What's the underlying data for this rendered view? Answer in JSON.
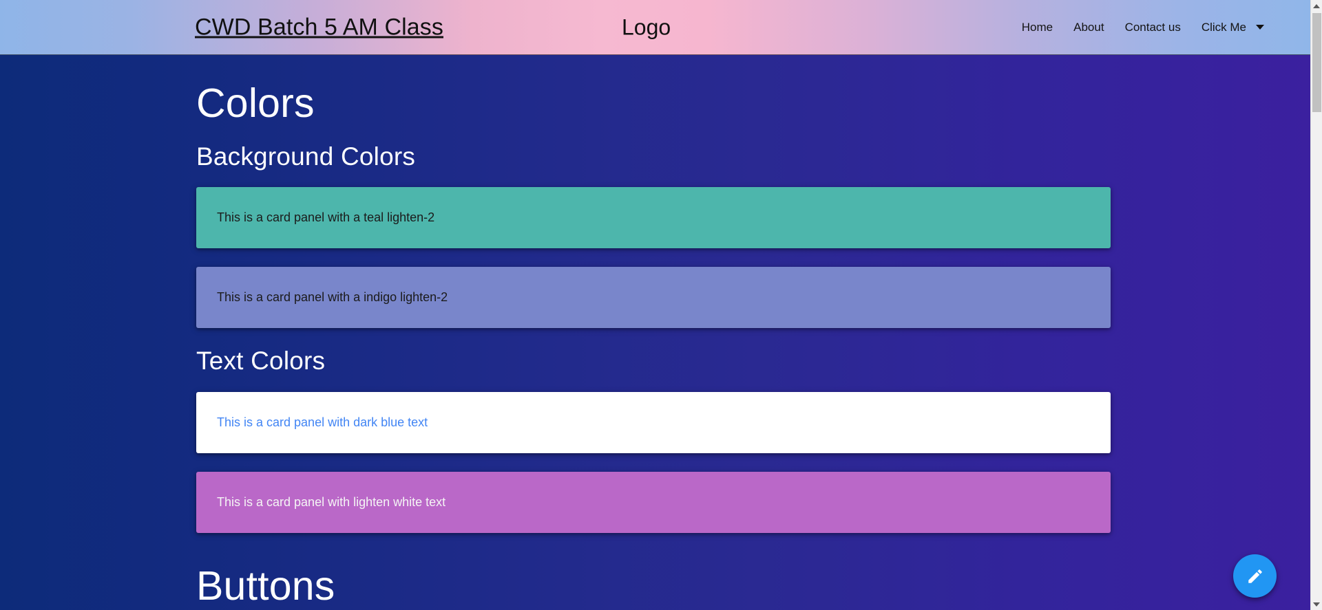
{
  "navbar": {
    "brand": "CWD Batch 5 AM Class",
    "logo_text": "Logo",
    "links": [
      {
        "label": "Home"
      },
      {
        "label": "About"
      },
      {
        "label": "Contact us"
      }
    ],
    "dropdown": {
      "label": "Click Me",
      "caret_icon": "chevron-down-icon"
    },
    "gradient_from": "#8fb5e8",
    "gradient_mid": "#f6b9d1",
    "gradient_to": "#90b6e9"
  },
  "page": {
    "title": "Colors",
    "background_gradient_from": "#0d2b7a",
    "background_gradient_to": "#3b209f"
  },
  "sections": [
    {
      "heading": "Background Colors",
      "cards": [
        {
          "text": "This is a card panel with a teal lighten-2",
          "background": "#4db6ac",
          "text_color": "#1b1b1b",
          "name": "card-panel-teal"
        },
        {
          "text": "This is a card panel with a indigo lighten-2",
          "background": "#7986cb",
          "text_color": "#1b1b1b",
          "name": "card-panel-indigo"
        }
      ]
    },
    {
      "heading": "Text Colors",
      "cards": [
        {
          "text": "This is a card panel with dark blue text",
          "background": "#ffffff",
          "text_color": "#4285f4",
          "name": "card-panel-white"
        },
        {
          "text": "This is a card panel with lighten white text",
          "background": "#ba68c8",
          "text_color": "#f5f5f5",
          "name": "card-panel-purple"
        }
      ]
    },
    {
      "heading": "Buttons",
      "cards": []
    }
  ],
  "fab": {
    "icon": "pencil-edit-icon",
    "color": "#2196f3"
  },
  "scrollbar": {
    "up_arrow_icon": "scroll-up-arrow-icon",
    "down_arrow_icon": "scroll-down-arrow-icon"
  }
}
